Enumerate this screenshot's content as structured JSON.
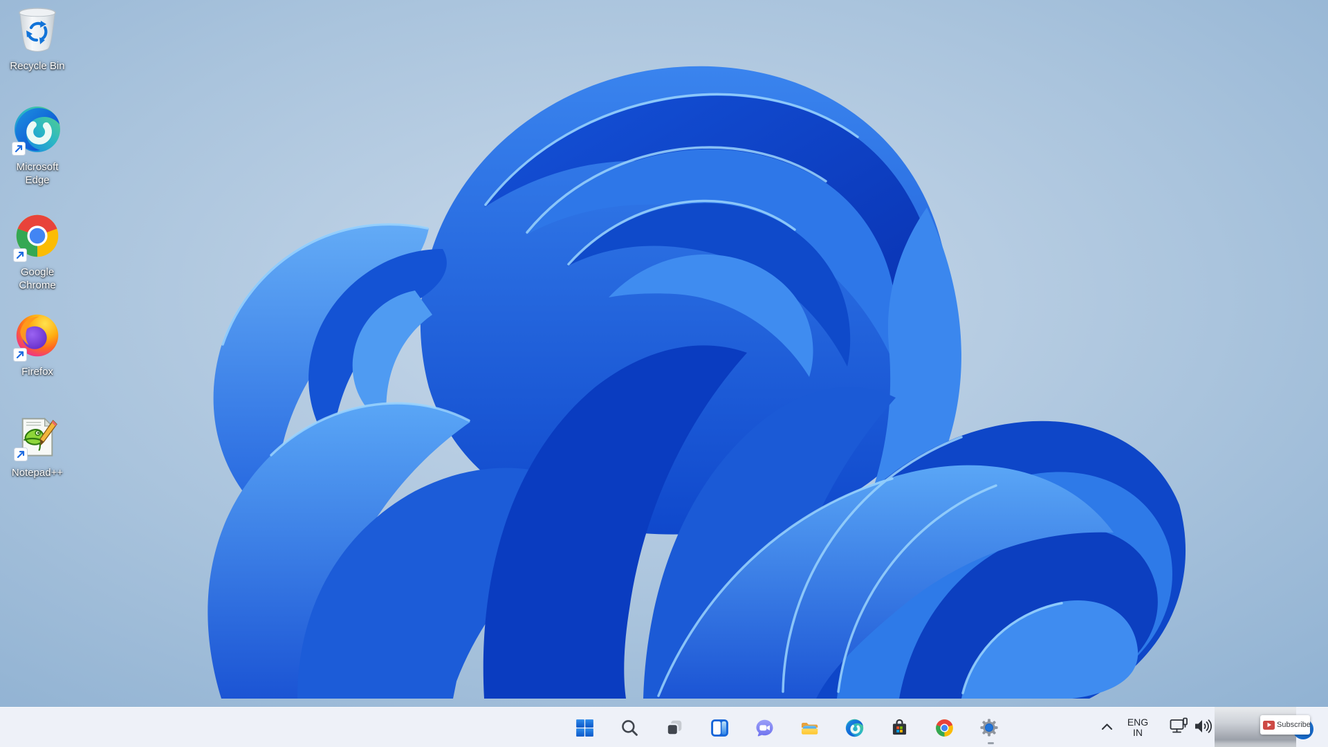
{
  "app": {
    "title": "Windows 11 Desktop"
  },
  "wallpaper": {
    "description": "Windows 11 blue bloom on light blue background",
    "bg_center": "#c9d9ea",
    "bg_edge": "#8fb1d2",
    "bloom_dark": "#0a3cc0",
    "bloom_mid": "#2e77e8",
    "bloom_light": "#57a2f4",
    "bloom_highlight": "#9bd4fd"
  },
  "desktop": {
    "icons": [
      {
        "label": "Recycle Bin",
        "icon": "recycle-bin-icon",
        "has_shortcut_arrow": false
      },
      {
        "label": "Microsoft Edge",
        "icon": "edge-icon",
        "has_shortcut_arrow": true
      },
      {
        "label": "Google Chrome",
        "icon": "chrome-icon",
        "has_shortcut_arrow": true
      },
      {
        "label": "Firefox",
        "icon": "firefox-icon",
        "has_shortcut_arrow": true
      },
      {
        "label": "Notepad++",
        "icon": "notepadpp-icon",
        "has_shortcut_arrow": true
      }
    ]
  },
  "taskbar": {
    "background": "#eef1f8",
    "buttons": [
      "start",
      "search",
      "task-view",
      "widgets",
      "chat",
      "file-explorer",
      "edge",
      "store",
      "chrome",
      "settings"
    ],
    "open_app_indicator_under": "settings"
  },
  "tray": {
    "chevron_icon": "hidden-icons-chevron",
    "language_line1": "ENG",
    "language_line2": "IN",
    "network_icon": "ethernet-monitor",
    "volume_icon": "speaker"
  },
  "overlay": {
    "subscribe_label": "Subscribe",
    "youtube_red": "#cd4a45",
    "pointer_circle_blue": "#1a74dc"
  }
}
